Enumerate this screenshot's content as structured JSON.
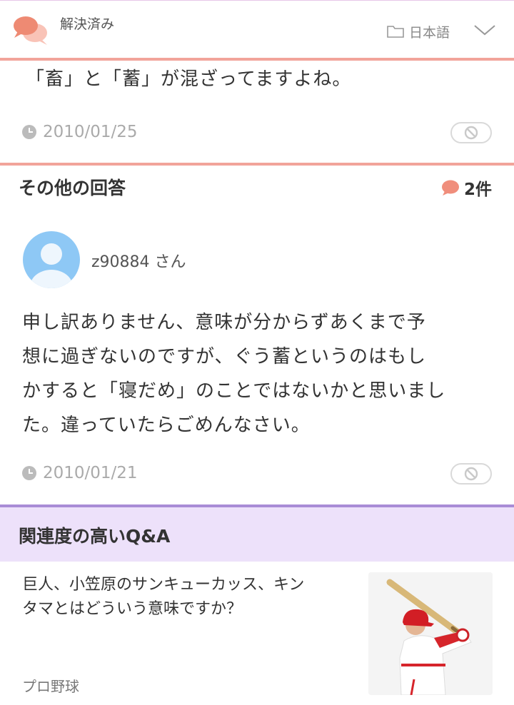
{
  "header": {
    "status_label": "解決済み",
    "language_label": "日本語",
    "icons": [
      "chat-bubbles-icon",
      "folder-icon",
      "chevron-down-icon"
    ]
  },
  "best_answer": {
    "text": "「畜」と「蓄」が混ざってますよね。",
    "date": "2010/01/25"
  },
  "other_answers": {
    "heading": "その他の回答",
    "count_label": "2件",
    "answer": {
      "username": "z90884 さん",
      "lines": [
        "申し訳ありません、意味が分からずあくまで予",
        "想に過ぎないのですが、ぐう蓄というのはもし",
        "かすると「寝だめ」のことではないかと思いまし",
        "た。違っていたらごめんなさい。"
      ],
      "date": "2010/01/21"
    }
  },
  "related": {
    "heading": "関連度の高いQ&A",
    "item": {
      "lines": [
        "巨人、小笠原のサンキューカッス、キン",
        "タマとはどういう意味ですか？"
      ],
      "category": "プロ野球"
    }
  },
  "colors": {
    "accent_pink": "#f2a49a",
    "accent_purple": "#a98cd6",
    "related_bg": "#ede1fa",
    "avatar_blue": "#8ec8f5"
  }
}
